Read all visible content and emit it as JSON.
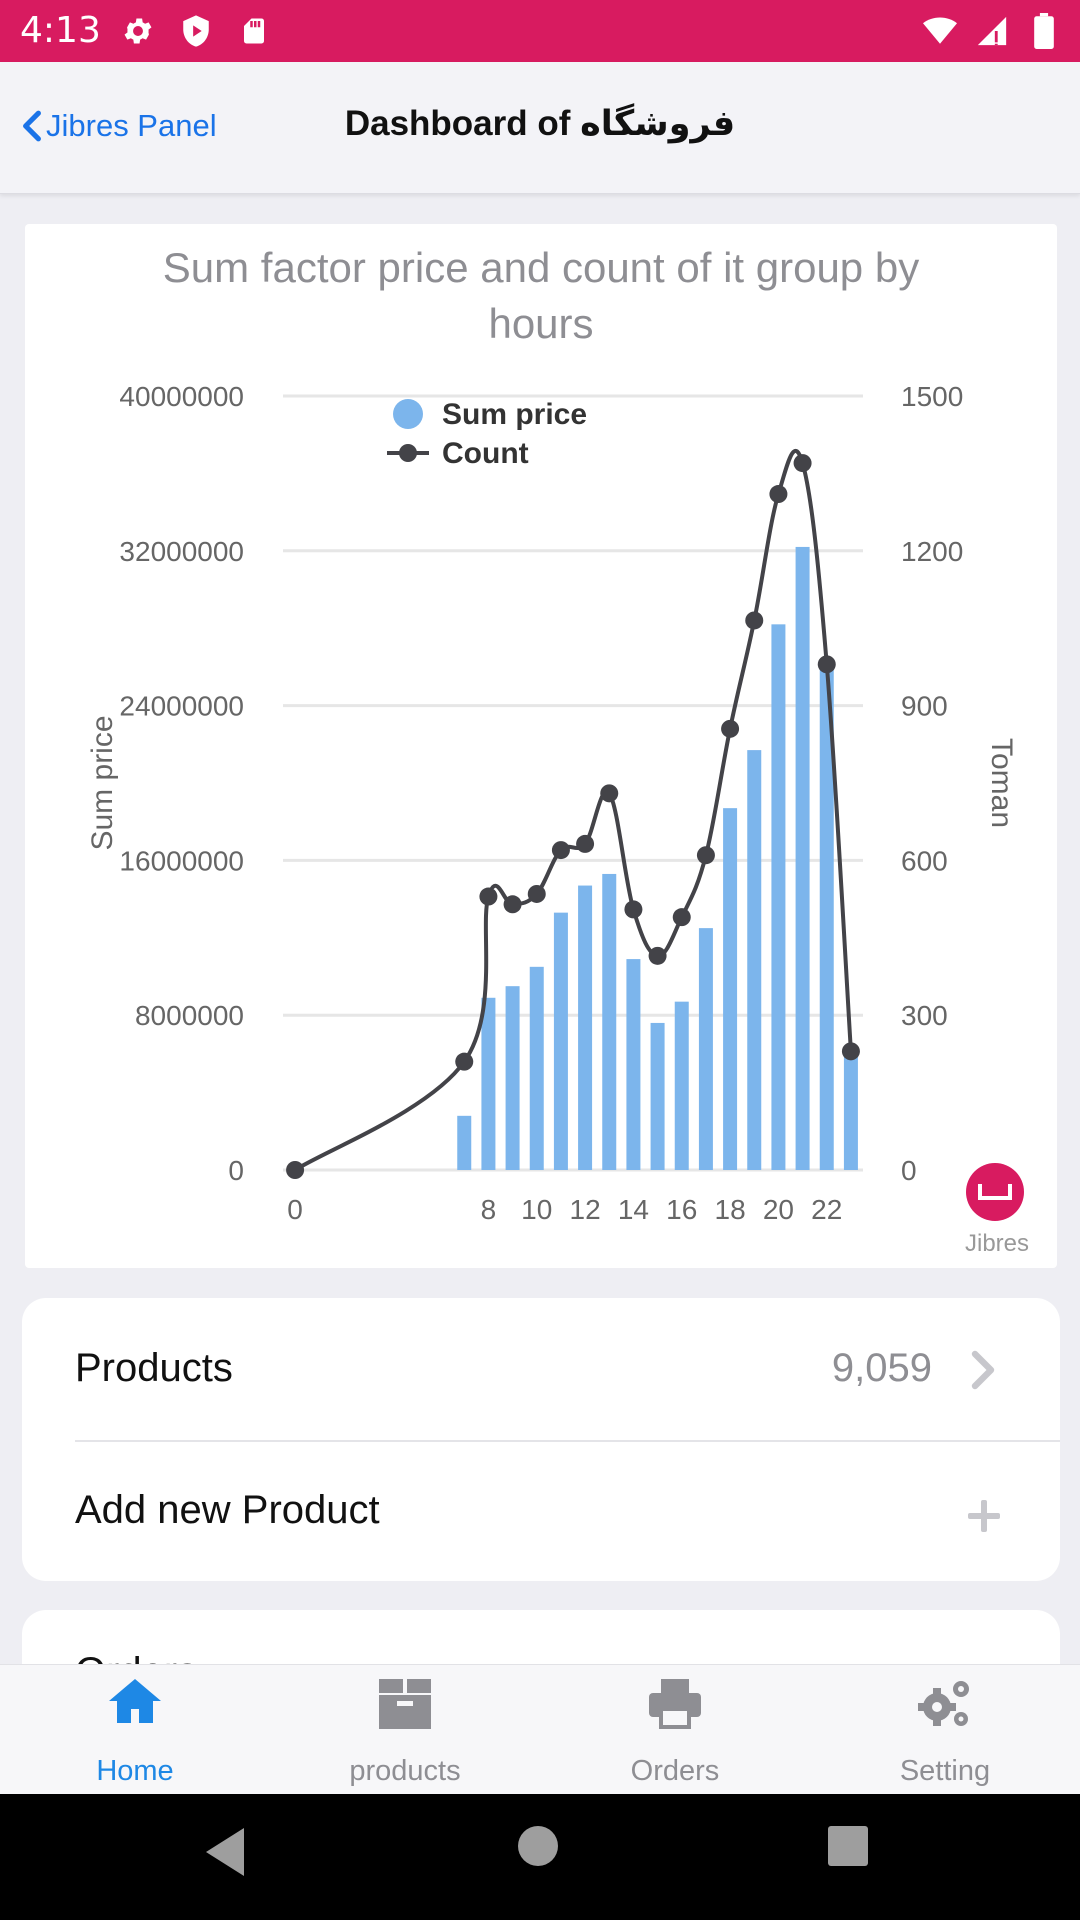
{
  "status_bar": {
    "time": "4:13",
    "icons": [
      "settings-gear-icon",
      "play-protect-icon",
      "sd-card-icon",
      "wifi-icon",
      "signal-icon",
      "battery-icon"
    ],
    "background": "#d81b60"
  },
  "header": {
    "back_label": "Jibres Panel",
    "title": "Dashboard of فروشگاه"
  },
  "chart_data": {
    "type": "bar+line",
    "title": "Sum factor price and count of it group by hours",
    "x": [
      0,
      7,
      8,
      9,
      10,
      11,
      12,
      13,
      14,
      15,
      16,
      17,
      18,
      19,
      20,
      21,
      22,
      23
    ],
    "x_tick_labels": [
      "0",
      "8",
      "10",
      "12",
      "14",
      "16",
      "18",
      "20",
      "22"
    ],
    "ylabel_left": "Sum price",
    "ylabel_right": "Toman",
    "ylim_left": [
      0,
      40000000
    ],
    "ylim_right": [
      0,
      1500
    ],
    "y_ticks_left": [
      "40000000",
      "32000000",
      "24000000",
      "16000000",
      "8000000",
      "0"
    ],
    "y_ticks_right": [
      "1500",
      "1200",
      "900",
      "600",
      "300",
      "0"
    ],
    "legend_position": "top-left",
    "grid": true,
    "series": [
      {
        "name": "Sum price",
        "kind": "bar",
        "axis": "left",
        "color": "#7cb5ec",
        "values": [
          0,
          2800000,
          8900000,
          9500000,
          10500000,
          13300000,
          14700000,
          15300000,
          10900000,
          7600000,
          8700000,
          12500000,
          18700000,
          21700000,
          28200000,
          32200000,
          26000000,
          6000000
        ]
      },
      {
        "name": "Count",
        "kind": "line",
        "axis": "right",
        "color": "#434348",
        "values": [
          0,
          210,
          530,
          515,
          535,
          620,
          632,
          730,
          505,
          415,
          490,
          610,
          855,
          1065,
          1310,
          1370,
          980,
          230
        ]
      }
    ],
    "credit": "Jibres"
  },
  "products": {
    "label": "Products",
    "count": "9,059",
    "add_label": "Add new Product"
  },
  "orders": {
    "label": "Orders"
  },
  "tabs": [
    {
      "label": "Home",
      "icon": "home-icon",
      "active": true
    },
    {
      "label": "products",
      "icon": "box-icon",
      "active": false
    },
    {
      "label": "Orders",
      "icon": "printer-icon",
      "active": false
    },
    {
      "label": "Setting",
      "icon": "gears-icon",
      "active": false
    }
  ],
  "colors": {
    "accent": "#1e88e5",
    "brand": "#d81b60",
    "link": "#1a73e8",
    "inactive": "#8e8e93"
  }
}
